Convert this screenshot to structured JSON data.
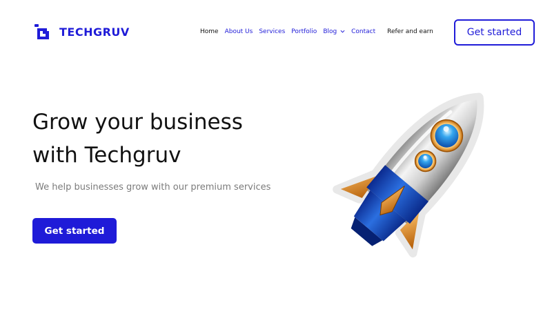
{
  "brand": {
    "name": "TECHGRUV",
    "accent_color": "#1f1bd8",
    "logo_icon": "g-monogram-icon"
  },
  "nav": {
    "items": [
      {
        "label": "Home"
      },
      {
        "label": "About Us"
      },
      {
        "label": "Services"
      },
      {
        "label": "Portfolio"
      },
      {
        "label": "Blog",
        "icon": "chevron-down-icon"
      },
      {
        "label": "Contact"
      },
      {
        "label": "Refer and earn"
      }
    ],
    "cta_label": "Get started"
  },
  "hero": {
    "title_line1": "Grow your business",
    "title_line2": "with Techgruv",
    "subtitle": "We help businesses grow with our premium services",
    "cta_label": "Get started",
    "illustration": "rocket-illustration"
  }
}
